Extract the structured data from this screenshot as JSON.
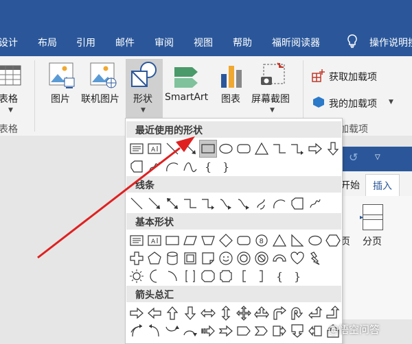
{
  "menu": {
    "items": [
      "设计",
      "布局",
      "引用",
      "邮件",
      "审阅",
      "视图",
      "帮助",
      "福昕阅读器"
    ],
    "tell_me": "操作说明搜"
  },
  "ribbon": {
    "table_label": "表格",
    "table_group": "表格",
    "picture_label": "图片",
    "online_picture_label": "联机图片",
    "shapes_label": "形状",
    "smartart_label": "SmartArt",
    "chart_label": "图表",
    "screenshot_label": "屏幕截图",
    "get_addins_label": "获取加载项",
    "my_addins_label": "我的加载项",
    "addins_group": "加载项"
  },
  "mini_window": {
    "tab_start": "开始",
    "tab_insert": "插入",
    "page_label": "页",
    "pagebreak_label": "分页"
  },
  "dropdown": {
    "sections": [
      "最近使用的形状",
      "线条",
      "基本形状",
      "箭头总汇"
    ]
  },
  "watermark": {
    "text": "@悟空问答"
  },
  "colors": {
    "brand": "#2b579a",
    "arrow": "#e02020",
    "addin_icon": "#c0392b"
  }
}
